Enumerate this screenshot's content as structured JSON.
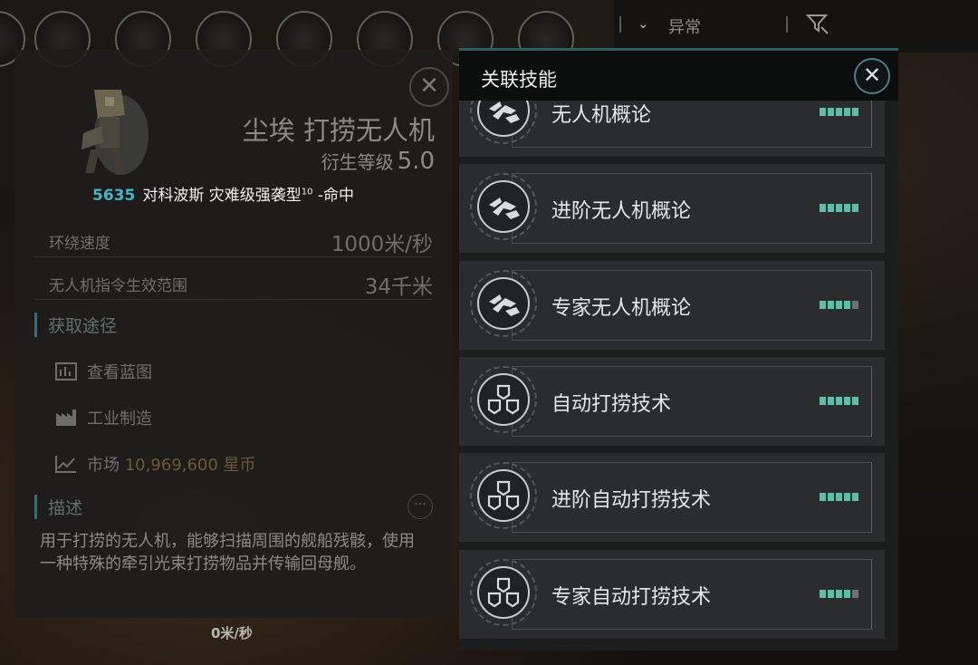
{
  "topbar": {
    "filter_label": "异常",
    "chevron_icon": "chevron-down-icon",
    "filter_icon": "filter-icon"
  },
  "item_panel": {
    "title": "尘埃 打捞无人机",
    "level_label": "衍生等级",
    "level_value": "5.0",
    "match_number": "5635",
    "match_text": "对科波斯 灾难级强袭型",
    "match_sup": "10",
    "match_suffix": "-命中",
    "stats": [
      {
        "label": "环绕速度",
        "value": "1000米/秒"
      },
      {
        "label": "无人机指令生效范围",
        "value": "34千米"
      }
    ],
    "source_heading": "获取途径",
    "sources": [
      {
        "icon": "blueprint-icon",
        "label": "查看蓝图"
      },
      {
        "icon": "factory-icon",
        "label": "工业制造"
      }
    ],
    "market_label": "市场",
    "market_price": "10,969,600 星币",
    "desc_heading": "描述",
    "description": "用于打捞的无人机，能够扫描周围的舰船残骸，使用一种特殊的牵引光束打捞物品并传输回母舰。"
  },
  "ground_speed": "0米/秒",
  "skills_panel": {
    "title": "关联技能",
    "skills": [
      {
        "name": "无人机概论",
        "icon": "drone-icon",
        "level": 5
      },
      {
        "name": "进阶无人机概论",
        "icon": "drone-icon",
        "level": 5
      },
      {
        "name": "专家无人机概论",
        "icon": "drone-icon",
        "level": 4
      },
      {
        "name": "自动打捞技术",
        "icon": "salvage-icon",
        "level": 5
      },
      {
        "name": "进阶自动打捞技术",
        "icon": "salvage-icon",
        "level": 5
      },
      {
        "name": "专家自动打捞技术",
        "icon": "salvage-icon",
        "level": 4
      }
    ],
    "max_level": 5,
    "accent": "#5ac1a8"
  }
}
